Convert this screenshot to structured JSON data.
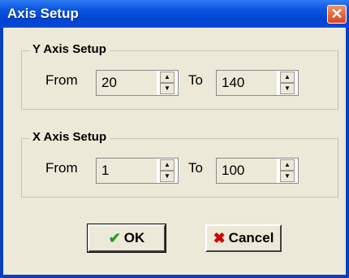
{
  "window": {
    "title": "Axis Setup",
    "close_glyph": "✕"
  },
  "y_axis": {
    "label": "Y Axis Setup",
    "from_label": "From",
    "from_value": "20",
    "to_label": "To",
    "to_value": "140"
  },
  "x_axis": {
    "label": "X Axis Setup",
    "from_label": "From",
    "from_value": "1",
    "to_label": "To",
    "to_value": "100"
  },
  "buttons": {
    "ok": "OK",
    "cancel": "Cancel"
  },
  "icons": {
    "ok": "check-icon",
    "cancel": "x-icon"
  },
  "colors": {
    "titlebar": "#0a55e0",
    "client": "#ece9d8",
    "close": "#d9461c",
    "ok_icon": "#2a9a2a",
    "cancel_icon": "#d00000"
  }
}
